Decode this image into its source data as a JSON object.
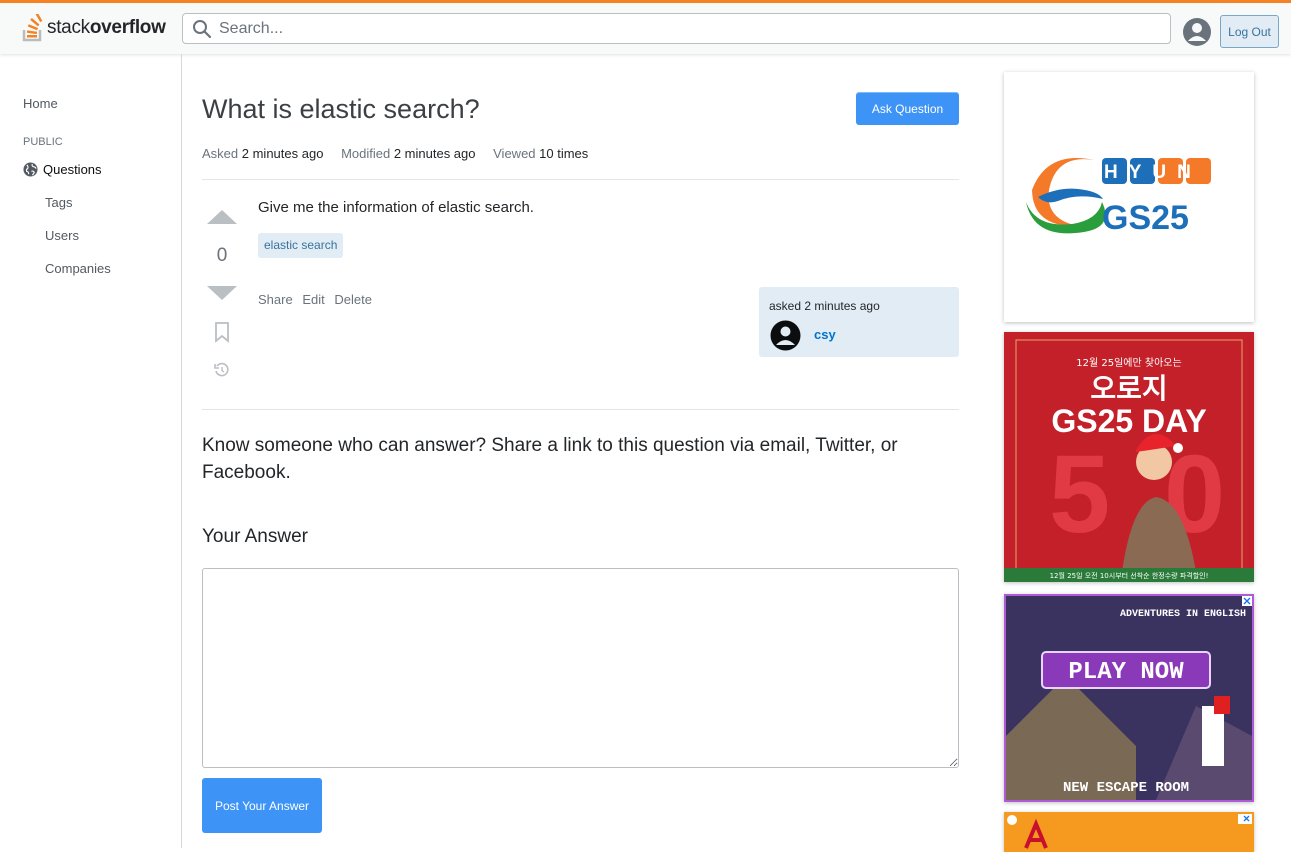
{
  "header": {
    "logo_light": "stack",
    "logo_bold": "overflow",
    "search_placeholder": "Search...",
    "logout_label": "Log Out",
    "accent": "#f48225"
  },
  "sidebar": {
    "home": "Home",
    "public": "PUBLIC",
    "questions": "Questions",
    "items": [
      {
        "label": "Tags"
      },
      {
        "label": "Users"
      },
      {
        "label": "Companies"
      }
    ]
  },
  "question": {
    "title": "What is elastic search?",
    "ask_button": "Ask Question",
    "asked_key": "Asked",
    "asked_val": "2 minutes ago",
    "modified_key": "Modified",
    "modified_val": "2 minutes ago",
    "viewed_key": "Viewed",
    "viewed_val": "10 times",
    "votes": "0",
    "body": "Give me the information of elastic search.",
    "tag": "elastic search",
    "actions": [
      "Share",
      "Edit",
      "Delete"
    ],
    "owner_asked": "asked 2 minutes ago",
    "owner_name": "csy"
  },
  "answer": {
    "share_prompt": "Know someone who can answer? Share a link to this question via email, Twitter, or Facebook.",
    "heading": "Your Answer",
    "post_button": "Post Your Answer"
  },
  "ads": {
    "ad1_top": "HYUN",
    "ad1_brand": "GS25",
    "ad2_top": "12월 25일에만 찾아오는",
    "ad2_title": "오로지",
    "ad2_sub": "GS25 DAY",
    "ad2_footer": "12월 25일 오전 10시부터 선착순 한정수량 파격할인!",
    "ad3_top": "ADVENTURES IN ENGLISH",
    "ad3_cta": "PLAY NOW",
    "ad3_bottom": "NEW ESCAPE ROOM"
  }
}
